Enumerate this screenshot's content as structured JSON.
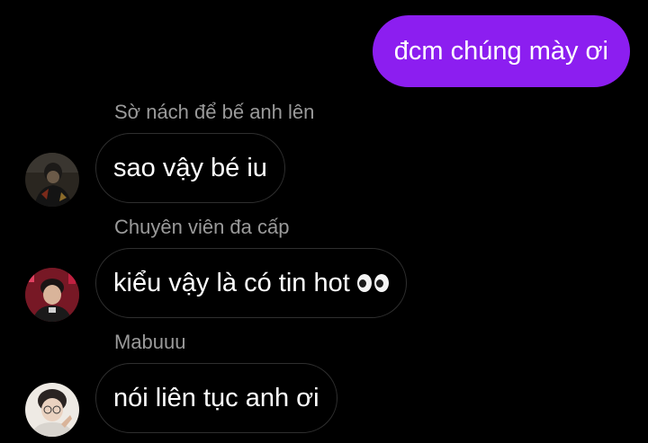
{
  "theme": {
    "background": "#000000",
    "sent_bubble_color": "#8c1ef0",
    "received_border_color": "#2f2f2f",
    "sender_name_color": "#9a9a9a"
  },
  "messages": [
    {
      "type": "sent",
      "text": "đcm chúng mày ơi"
    },
    {
      "type": "received",
      "sender": "Sờ nách để bế anh lên",
      "text": "sao vậy bé iu",
      "avatar_icon": "user-avatar-1"
    },
    {
      "type": "received",
      "sender": "Chuyên viên đa cấp",
      "text": "kiểu vậy là có tin hot",
      "emoji": "eyes-emoji",
      "avatar_icon": "user-avatar-2"
    },
    {
      "type": "received",
      "sender": "Mabuuu",
      "text": "nói liên tục anh ơi",
      "avatar_icon": "user-avatar-3"
    }
  ]
}
